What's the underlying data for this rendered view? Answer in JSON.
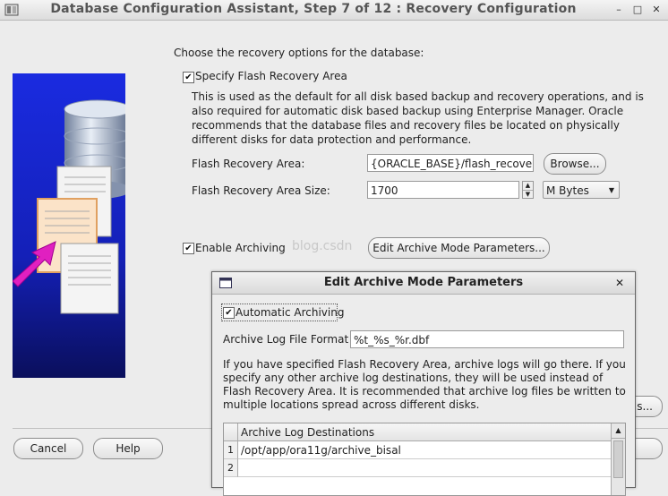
{
  "window": {
    "title": "Database Configuration Assistant, Step 7 of 12 : Recovery Configuration",
    "minimize": "–",
    "maximize": "□",
    "close": "✕"
  },
  "main": {
    "prompt": "Choose the recovery options for the database:",
    "flash_checkbox_label": "Specify Flash Recovery Area",
    "flash_checkbox_checked": true,
    "flash_description": "This is used as the default for all disk based backup and recovery operations, and is also required for automatic disk based backup using Enterprise Manager. Oracle recommends that the database files and recovery files be located on physically different disks for data protection and performance.",
    "flash_area_label": "Flash Recovery Area:",
    "flash_area_value": "{ORACLE_BASE}/flash_recovery_",
    "browse_label": "Browse...",
    "flash_size_label": "Flash Recovery Area Size:",
    "flash_size_value": "1700",
    "size_unit": "M Bytes",
    "archiving_checkbox_label": "Enable Archiving",
    "archiving_checkbox_checked": true,
    "edit_archive_button": "Edit Archive Mode Parameters..."
  },
  "footer": {
    "cancel_label": "Cancel",
    "help_label": "Help",
    "partial_button": "s..."
  },
  "watermark": "blog.csdn",
  "dialog": {
    "title": "Edit Archive Mode Parameters",
    "close": "✕",
    "auto_archiving_label": "Automatic Archiving",
    "auto_archiving_checked": true,
    "log_format_label": "Archive Log File Format",
    "log_format_value": "%t_%s_%r.dbf",
    "description": "If you have specified Flash Recovery Area, archive logs will go there. If you specify any other archive log destinations, they will be used instead of Flash Recovery Area. It is recommended that archive log files be written to multiple locations spread across different disks.",
    "destinations_header": "Archive Log Destinations",
    "destinations": [
      {
        "num": "1",
        "path": "/opt/app/ora11g/archive_bisal"
      },
      {
        "num": "2",
        "path": ""
      }
    ]
  }
}
